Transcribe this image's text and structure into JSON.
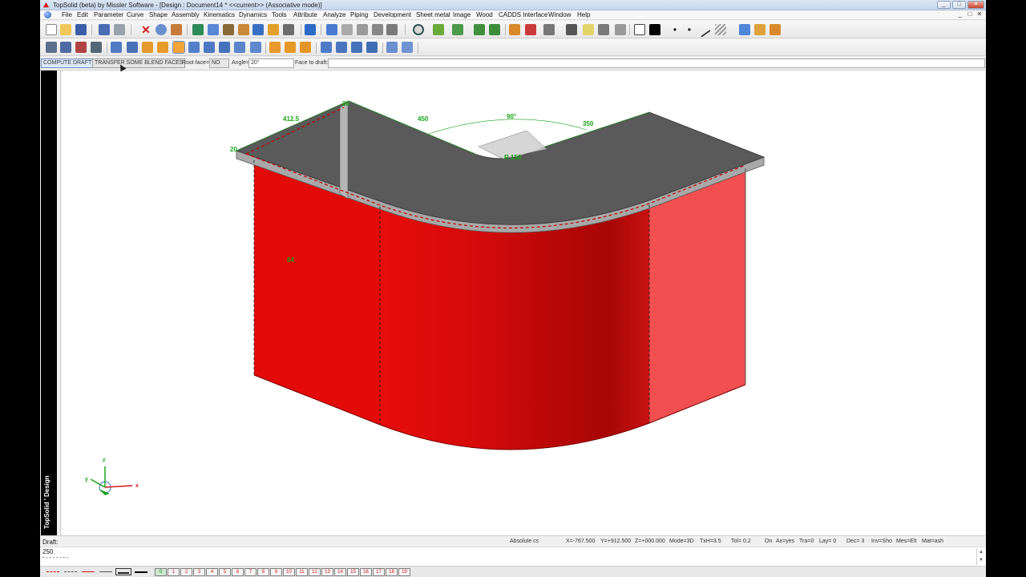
{
  "window": {
    "title": "TopSolid (beta) by Missler Software - [Design : Document14 *  <<current>> (Associative mode)]",
    "controls": [
      "_",
      "□",
      "✕"
    ]
  },
  "menu": {
    "items": [
      "File",
      "Edit",
      "Parameter",
      "Curve",
      "Shape",
      "Assembly",
      "Kinematics",
      "Dynamics",
      "Tools",
      "Attribute",
      "Analyze",
      "Piping",
      "Development",
      "Sheet metal",
      "Image",
      "Wood",
      "CADDS Interface",
      "Window",
      "Help"
    ],
    "mdi_controls": [
      "_",
      "□",
      "✕"
    ]
  },
  "options": {
    "compute_draft": "COMPUTE DRAFT",
    "transfer_blend": "TRANSFER SOME BLEND FACES",
    "root_face_label": "Root face=",
    "root_face_value": "NO",
    "angle_label": "Angle=",
    "angle_value": "20°",
    "face_to_draft_label": "Face to draft:"
  },
  "brand": {
    "text": "TopSolid ' Design"
  },
  "model": {
    "dimensions": {
      "d1": "412.5",
      "d2": "450",
      "d3": "90°",
      "d4": "350",
      "d5": "64",
      "d6": "20",
      "d7": "20",
      "d8": "R 150"
    },
    "axes": {
      "x": "x",
      "y": "y",
      "z": "z"
    }
  },
  "status": {
    "coord_system": "Absolute cs",
    "x": "X=-767.500",
    "y": "Y=+912.500",
    "z": "Z=+000.000",
    "mode": "Mode=3D",
    "txh": "TxH=3.5",
    "tol": "Tol=  0.2",
    "on": "On",
    "ax": "Ax=yes",
    "tra": "Tra=0",
    "lay": "Lay=  0",
    "dec": "Dec= 3",
    "inv": "Inv=Sho",
    "mes": "Mes=Elt",
    "mat": "Mat=ash"
  },
  "command": {
    "prompt": "Draft:",
    "value": "250",
    "history": "- - - - - - - -"
  },
  "layers": [
    "0",
    "1",
    "2",
    "3",
    "4",
    "5",
    "6",
    "7",
    "8",
    "9",
    "10",
    "11",
    "12",
    "13",
    "14",
    "15",
    "16",
    "17",
    "18",
    "19"
  ],
  "colors": {
    "accent_red": "#e01010",
    "dim_green": "#1aa51a",
    "top_grey": "#555555"
  }
}
